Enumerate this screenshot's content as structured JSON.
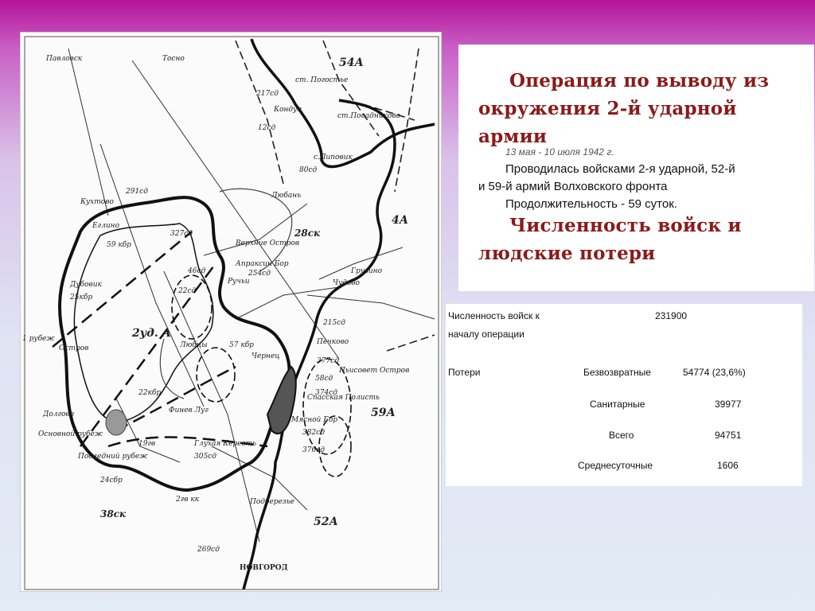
{
  "map": {
    "labels": {
      "pavlovsk": "Павловск",
      "tosno": "Тосно",
      "army54": "54А",
      "pogostye": "ст. Погостье",
      "div217_top": "217сд",
      "kondui": "Кондуя",
      "div12": "12сд",
      "posadnikovo": "ст.Посадниково",
      "lipovik": "с.Липовик",
      "div80": "80сд",
      "kukhtovo": "Кухтово",
      "div291": "291сд",
      "lyuban": "Любань",
      "army4": "4А",
      "div327": "327сд",
      "eglino": "Еглино",
      "div59": "59 кбр",
      "verkh_ostrov": "Верхние Остров",
      "div28": "28ск",
      "apraksin": "Апраксин Бор",
      "div254": "254сд",
      "ruchyi": "Ручьи",
      "chudovo": "Чудово",
      "gruzino": "Грузино",
      "dubovik": "Дубовик",
      "div25": "25кбр",
      "div46": "46сд",
      "div22": "22сд",
      "div21_5": "215сд",
      "rubezh1": "1 рубеж",
      "ostrov": "Остров",
      "army2": "2уд. А",
      "div57": "57 кбр",
      "lyubtsy": "Любцы",
      "pechkovo": "Печково",
      "chernets": "Чернец",
      "div377": "377сд",
      "sosnovets": "Пьисовет Остров",
      "div22kbr": "22кбр",
      "div58": "58сд",
      "div374": "374сд",
      "myasnoy_bor": "Мясной Бор",
      "spasskaya_polist": "Спасская Полисть",
      "finev_lug": "Финев Луг",
      "army59": "59А",
      "dolgovo": "Долгово",
      "osnovnoy": "Основной рубеж",
      "posledniy": "Последний рубеж",
      "glukhaya": "Глухая Кересть",
      "div305": "305сд",
      "div19": "19гв",
      "div24": "24сбр",
      "div382": "382сд",
      "div376": "376сд",
      "army38": "38ск",
      "div2": "2гв кк",
      "podberezye": "Подберезье",
      "army52": "52А",
      "div269": "269сд",
      "novgorod": "НОВГОРОД"
    }
  },
  "title": {
    "line1": "Операция по выводу из",
    "line2": "окружения 2-й ударной",
    "line3": "армии",
    "date": "13 мая - 10 июля 1942 г.",
    "info1": "Проводилась войсками 2-я ударной, 52-й",
    "info2": "и 59-й армий Волховского фронта",
    "duration": "Продолжительность - 59 суток.",
    "section1": "Численность войск и",
    "section2": "людские потери"
  },
  "stats": {
    "strength_label_1": "Численность войск к",
    "strength_label_2": "началу операции",
    "strength_value": "231900",
    "losses_label": "Потери",
    "rows": [
      {
        "type": "Безвозвратные",
        "value": "54774 (23,6%)"
      },
      {
        "type": "Санитарные",
        "value": "39977"
      },
      {
        "type": "Всего",
        "value": "94751"
      },
      {
        "type": "Среднесуточные",
        "value": "1606"
      }
    ]
  },
  "colors": {
    "title_red": "#8b1a1a",
    "bg_top": "#b5129b",
    "bg_bottom": "#e3ebf6"
  }
}
